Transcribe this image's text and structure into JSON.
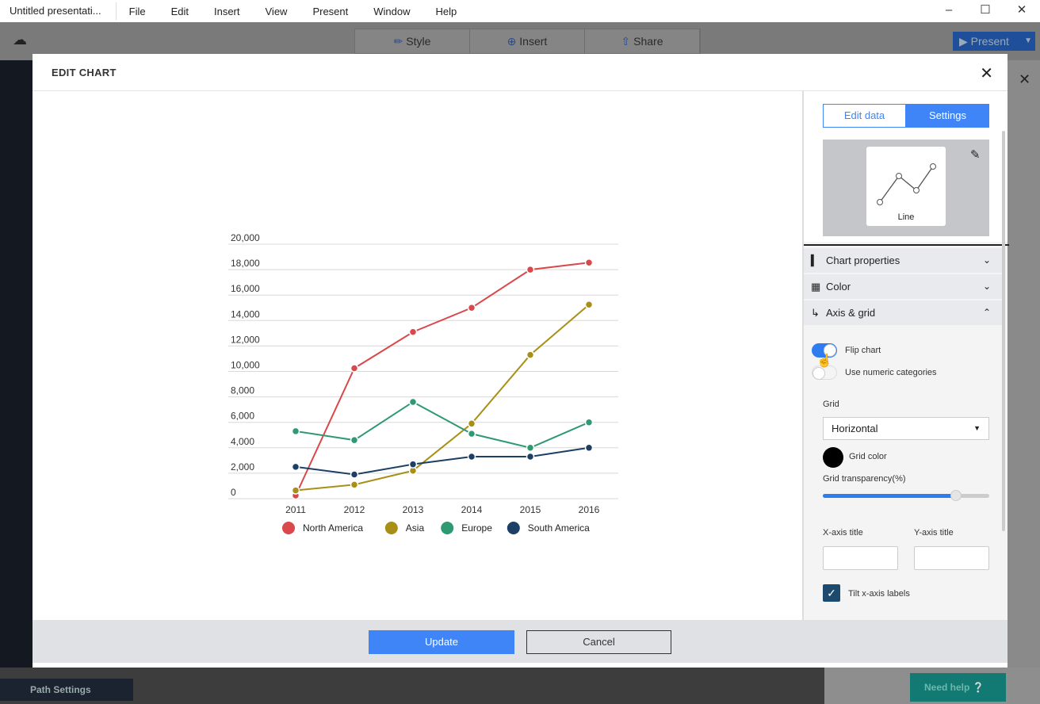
{
  "app": {
    "title": "Untitled presentati...",
    "menu": [
      "File",
      "Edit",
      "Insert",
      "View",
      "Present",
      "Window",
      "Help"
    ],
    "toolbar": {
      "style": "Style",
      "insert": "Insert",
      "share": "Share",
      "present": "Present"
    },
    "path_settings": "Path Settings",
    "need_help": "Need help"
  },
  "modal": {
    "title": "EDIT CHART",
    "update": "Update",
    "cancel": "Cancel"
  },
  "side": {
    "tabs": {
      "edit_data": "Edit data",
      "settings": "Settings"
    },
    "active_tab": "Settings",
    "chart_type": "Line",
    "sections": [
      "Chart properties",
      "Color",
      "Axis & grid"
    ],
    "flip_chart": {
      "label": "Flip chart",
      "on": true
    },
    "numeric_categories": {
      "label": "Use numeric categories",
      "on": false
    },
    "grid_label": "Grid",
    "grid_value": "Horizontal",
    "grid_color_label": "Grid color",
    "grid_color": "#000000",
    "transparency_label": "Grid transparency(%)",
    "transparency": 80,
    "x_axis_title_label": "X-axis title",
    "x_axis_title": "",
    "y_axis_title_label": "Y-axis title",
    "y_axis_title": "",
    "tilt_label": "Tilt x-axis labels",
    "tilt": true
  },
  "chart_data": {
    "type": "line",
    "categories": [
      "2011",
      "2012",
      "2013",
      "2014",
      "2015",
      "2016"
    ],
    "ylim": [
      0,
      20000
    ],
    "yticks": [
      "0",
      "2,000",
      "4,000",
      "6,000",
      "8,000",
      "10,000",
      "12,000",
      "14,000",
      "16,000",
      "18,000",
      "20,000"
    ],
    "grid": "horizontal",
    "legend": "bottom",
    "series": [
      {
        "name": "North America",
        "color": "#d9484b",
        "values": [
          250,
          10250,
          13100,
          15000,
          18000,
          18550
        ]
      },
      {
        "name": "Asia",
        "color": "#a88f16",
        "values": [
          650,
          1100,
          2200,
          5900,
          11300,
          15250
        ]
      },
      {
        "name": "Europe",
        "color": "#2f9a72",
        "values": [
          5300,
          4600,
          7600,
          5100,
          4000,
          6000
        ]
      },
      {
        "name": "South America",
        "color": "#1c3f66",
        "values": [
          2500,
          1900,
          2700,
          3300,
          3300,
          4000
        ]
      }
    ]
  }
}
